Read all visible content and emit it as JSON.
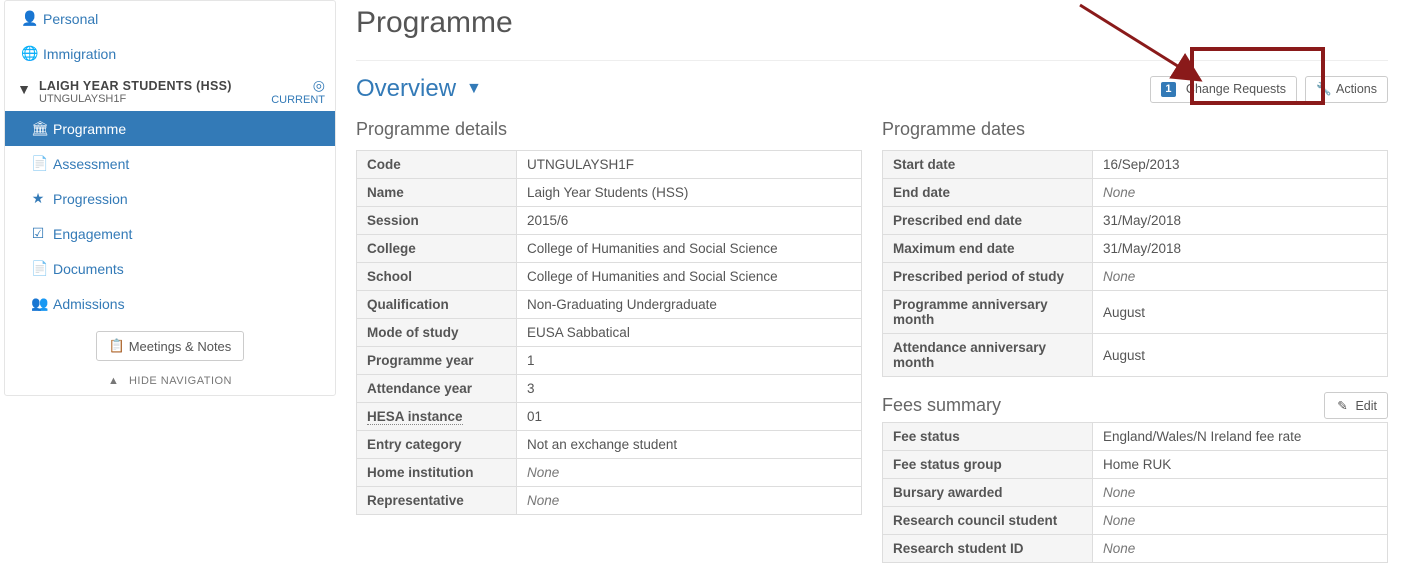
{
  "sidebar": {
    "top_items": [
      {
        "icon": "👤",
        "label": "Personal"
      },
      {
        "icon": "🌐",
        "label": "Immigration"
      }
    ],
    "group": {
      "title": "LAIGH YEAR STUDENTS (HSS)",
      "code": "UTNGULAYSH1F",
      "status": "CURRENT"
    },
    "sub_items": [
      {
        "icon": "🏛",
        "label": "Programme",
        "active": true
      },
      {
        "icon": "📄",
        "label": "Assessment"
      },
      {
        "icon": "★",
        "label": "Progression"
      },
      {
        "icon": "☑",
        "label": "Engagement"
      },
      {
        "icon": "📄",
        "label": "Documents"
      },
      {
        "icon": "👥",
        "label": "Admissions"
      }
    ],
    "meetings_button": "Meetings & Notes",
    "hide_nav": "HIDE NAVIGATION"
  },
  "page": {
    "title": "Programme",
    "overview_label": "Overview",
    "change_requests_label": "Change Requests",
    "change_requests_count": "1",
    "actions_label": "Actions"
  },
  "programme_details": {
    "heading": "Programme details",
    "rows": {
      "code": {
        "label": "Code",
        "value": "UTNGULAYSH1F"
      },
      "name": {
        "label": "Name",
        "value": "Laigh Year Students (HSS)"
      },
      "session": {
        "label": "Session",
        "value": "2015/6"
      },
      "college": {
        "label": "College",
        "value": "College of Humanities and Social Science"
      },
      "school": {
        "label": "School",
        "value": "College of Humanities and Social Science"
      },
      "qual": {
        "label": "Qualification",
        "value": "Non-Graduating Undergraduate"
      },
      "mode": {
        "label": "Mode of study",
        "value": "EUSA Sabbatical"
      },
      "pyear": {
        "label": "Programme year",
        "value": "1"
      },
      "ayear": {
        "label": "Attendance year",
        "value": "3"
      },
      "hesa": {
        "label": "HESA instance",
        "value": "01",
        "hesa": true
      },
      "entry": {
        "label": "Entry category",
        "value": "Not an exchange student"
      },
      "home": {
        "label": "Home institution",
        "value": "None",
        "none": true
      },
      "rep": {
        "label": "Representative",
        "value": "None",
        "none": true
      }
    }
  },
  "programme_dates": {
    "heading": "Programme dates",
    "rows": {
      "start": {
        "label": "Start date",
        "value": "16/Sep/2013"
      },
      "end": {
        "label": "End date",
        "value": "None",
        "none": true
      },
      "pend": {
        "label": "Prescribed end date",
        "value": "31/May/2018"
      },
      "maxend": {
        "label": "Maximum end date",
        "value": "31/May/2018"
      },
      "pperiod": {
        "label": "Prescribed period of study",
        "value": "None",
        "none": true
      },
      "pann": {
        "label": "Programme anniversary month",
        "value": "August"
      },
      "aann": {
        "label": "Attendance anniversary month",
        "value": "August"
      }
    }
  },
  "fees": {
    "heading": "Fees summary",
    "edit_label": "Edit",
    "rows": {
      "status": {
        "label": "Fee status",
        "value": "England/Wales/N Ireland fee rate"
      },
      "group": {
        "label": "Fee status group",
        "value": "Home RUK"
      },
      "bursary": {
        "label": "Bursary awarded",
        "value": "None",
        "none": true
      },
      "research": {
        "label": "Research council student",
        "value": "None",
        "none": true
      },
      "researchid": {
        "label": "Research student ID",
        "value": "None",
        "none": true
      }
    }
  }
}
